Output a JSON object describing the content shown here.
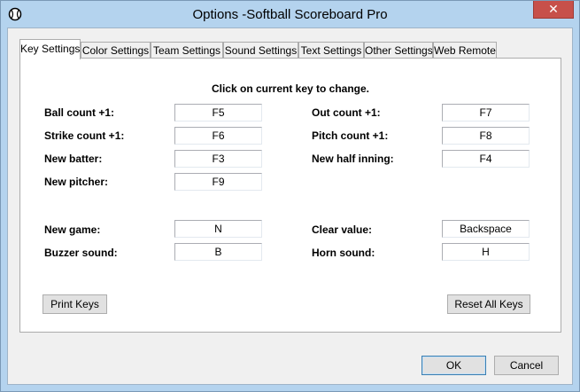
{
  "window": {
    "title": "Options -Softball Scoreboard Pro",
    "close_glyph": "✕"
  },
  "tabs": [
    {
      "label": "Key Settings",
      "active": true
    },
    {
      "label": "Color Settings",
      "active": false
    },
    {
      "label": "Team Settings",
      "active": false
    },
    {
      "label": "Sound Settings",
      "active": false
    },
    {
      "label": "Text Settings",
      "active": false
    },
    {
      "label": "Other Settings",
      "active": false
    },
    {
      "label": "Web Remote",
      "active": false
    }
  ],
  "panel": {
    "instruction": "Click on current key to change.",
    "keys": {
      "ball_count": {
        "label": "Ball count +1:",
        "value": "F5"
      },
      "strike_count": {
        "label": "Strike count +1:",
        "value": "F6"
      },
      "new_batter": {
        "label": "New batter:",
        "value": "F3"
      },
      "new_pitcher": {
        "label": "New pitcher:",
        "value": "F9"
      },
      "out_count": {
        "label": "Out count +1:",
        "value": "F7"
      },
      "pitch_count": {
        "label": "Pitch count +1:",
        "value": "F8"
      },
      "new_half_inning": {
        "label": "New half inning:",
        "value": "F4"
      },
      "new_game": {
        "label": "New game:",
        "value": "N"
      },
      "buzzer_sound": {
        "label": "Buzzer sound:",
        "value": "B"
      },
      "clear_value": {
        "label": "Clear value:",
        "value": "Backspace"
      },
      "horn_sound": {
        "label": "Horn sound:",
        "value": "H"
      }
    },
    "print_keys_label": "Print Keys",
    "reset_all_keys_label": "Reset All Keys"
  },
  "footer": {
    "ok_label": "OK",
    "cancel_label": "Cancel"
  }
}
